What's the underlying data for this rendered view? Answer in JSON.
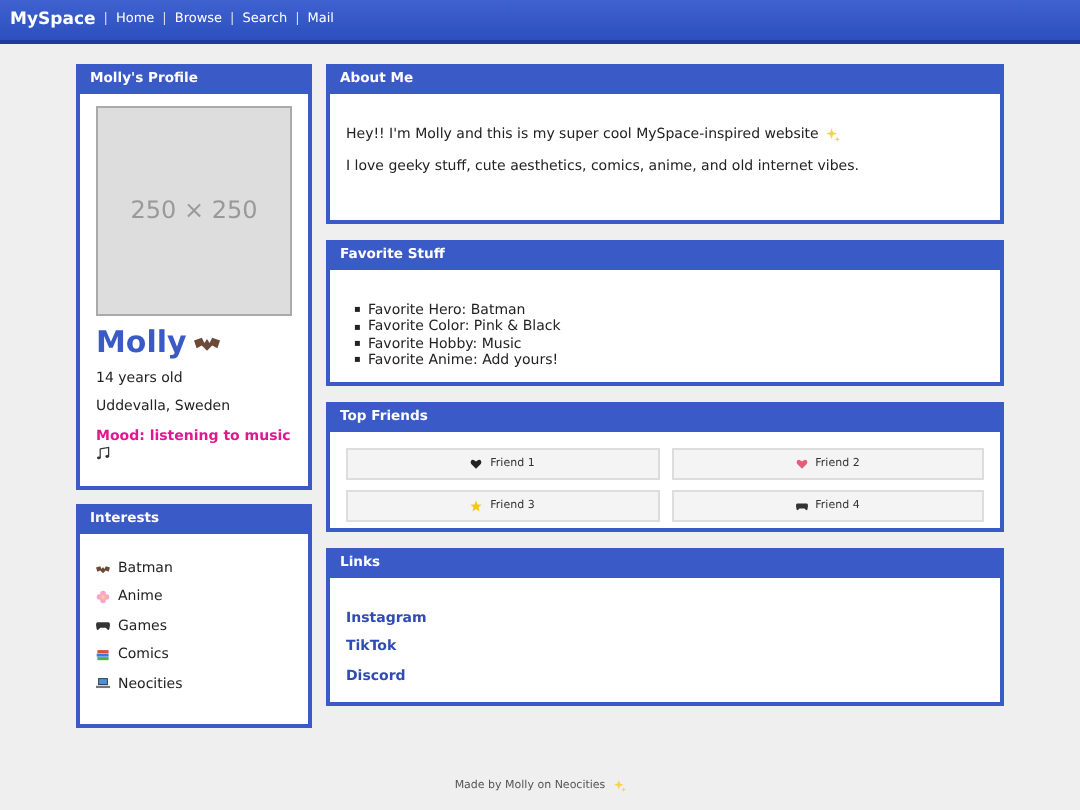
{
  "navbar": {
    "brand": "MySpace",
    "links": [
      "Home",
      "Browse",
      "Search",
      "Mail"
    ],
    "separator": "|"
  },
  "profile": {
    "title": "Molly's Profile",
    "photo_label": "250 × 250",
    "name": "Molly",
    "age": "14 years old",
    "location": "Uddevalla, Sweden",
    "mood": "Mood: listening to music"
  },
  "interests": {
    "title": "Interests",
    "items": [
      "Batman",
      "Anime",
      "Games",
      "Comics",
      "Neocities"
    ]
  },
  "about": {
    "title": "About Me",
    "paragraphs": [
      "Hey!! I'm Molly and this is my super cool MySpace-inspired website",
      "I love geeky stuff, cute aesthetics, comics, anime, and old internet vibes."
    ]
  },
  "favorites": {
    "title": "Favorite Stuff",
    "marker": "▪",
    "items": [
      "Favorite Hero: Batman",
      "Favorite Color: Pink & Black",
      "Favorite Hobby: Music",
      "Favorite Anime: Add yours!"
    ]
  },
  "friends": {
    "title": "Top Friends",
    "items": [
      "Friend 1",
      "Friend 2",
      "Friend 3",
      "Friend 4"
    ]
  },
  "links": {
    "title": "Links",
    "items": [
      "Instagram",
      "TikTok",
      "Discord"
    ]
  },
  "footer": "Made by Molly on Neocities"
}
